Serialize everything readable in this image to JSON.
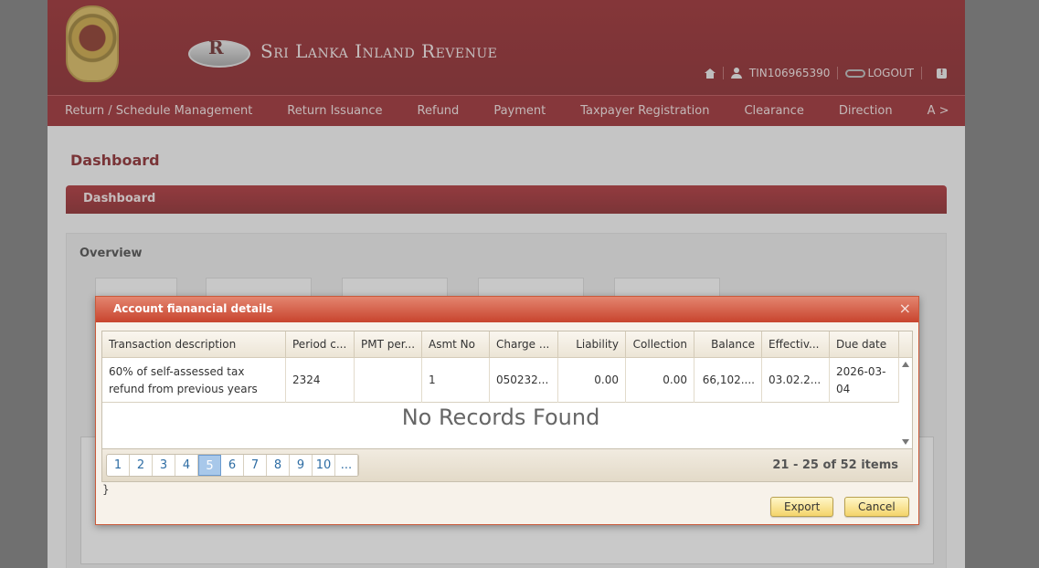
{
  "header": {
    "site_title": "Sri Lanka Inland Revenue",
    "user_tin": "TIN106965390",
    "logout_label": "LOGOUT",
    "alert_symbol": "!"
  },
  "nav": {
    "items": [
      "Return / Schedule Management",
      "Return Issuance",
      "Refund",
      "Payment",
      "Taxpayer Registration",
      "Clearance",
      "Direction",
      "A >"
    ]
  },
  "page": {
    "title": "Dashboard",
    "panel_title": "Dashboard",
    "overview_title": "Overview"
  },
  "modal": {
    "title": "Account fianancial details",
    "close_symbol": "×",
    "columns": [
      "Transaction description",
      "Period c...",
      "PMT per...",
      "Asmt No",
      "Charge ...",
      "Liability",
      "Collection",
      "Balance",
      "Effectiv...",
      "Due date"
    ],
    "row": {
      "description": "60% of self-assessed tax refund from previous years",
      "period": "2324",
      "pmt_period": "",
      "asmt_no": "1",
      "charge": "050232...",
      "liability": "0.00",
      "collection": "0.00",
      "balance": "66,102....",
      "effective": "03.02.2...",
      "due_date": "2026-03-04"
    },
    "no_records": "No Records Found",
    "pager": {
      "pages": [
        "1",
        "2",
        "3",
        "4",
        "5",
        "6",
        "7",
        "8",
        "9",
        "10",
        "..."
      ],
      "current_page": "5",
      "info": "21 - 25 of 52 items"
    },
    "brace_text": "}",
    "export_label": "Export",
    "cancel_label": "Cancel"
  },
  "colors": {
    "brand_red": "#8c0d12",
    "modal_header": "#d45a40",
    "active_page": "#a8c8ea"
  }
}
